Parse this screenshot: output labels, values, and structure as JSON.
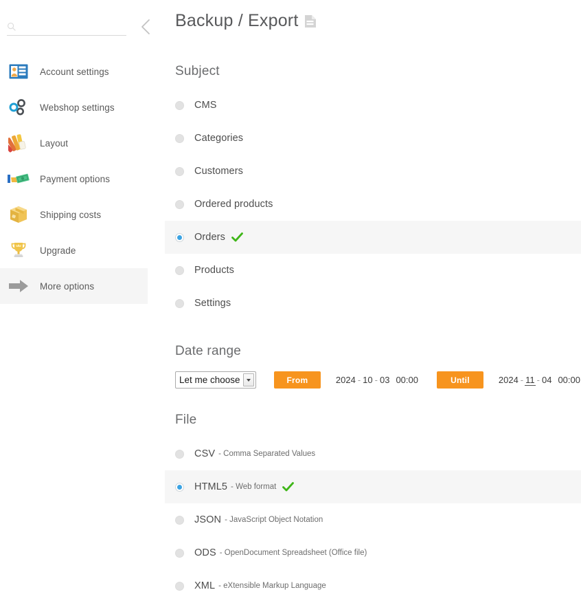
{
  "sidebar": {
    "search": {
      "value": "",
      "placeholder": "",
      "icon": "search-icon"
    },
    "collapse_icon": "chevron-left-icon",
    "items": [
      {
        "label": "Account settings",
        "icon": "id-card-icon",
        "active": false
      },
      {
        "label": "Webshop settings",
        "icon": "gears-icon",
        "active": false
      },
      {
        "label": "Layout",
        "icon": "color-fan-icon",
        "active": false
      },
      {
        "label": "Payment options",
        "icon": "money-hand-icon",
        "active": false
      },
      {
        "label": "Shipping costs",
        "icon": "box-icon",
        "active": false
      },
      {
        "label": "Upgrade",
        "icon": "trophy-icon",
        "active": false
      },
      {
        "label": "More options",
        "icon": "arrow-right-icon",
        "active": true
      }
    ]
  },
  "main": {
    "title": "Backup / Export",
    "title_icon": "document-icon",
    "subject": {
      "heading": "Subject",
      "options": [
        {
          "label": "CMS",
          "selected": false
        },
        {
          "label": "Categories",
          "selected": false
        },
        {
          "label": "Customers",
          "selected": false
        },
        {
          "label": "Ordered products",
          "selected": false
        },
        {
          "label": "Orders",
          "selected": true
        },
        {
          "label": "Products",
          "selected": false
        },
        {
          "label": "Settings",
          "selected": false
        }
      ]
    },
    "date_range": {
      "heading": "Date range",
      "select": {
        "value": "Let me choose",
        "options": [
          "Let me choose"
        ]
      },
      "from": {
        "button_label": "From",
        "year": "2024",
        "month": "10",
        "day": "03",
        "time": "00:00",
        "focused_segment": ""
      },
      "until": {
        "button_label": "Until",
        "year": "2024",
        "month": "11",
        "day": "04",
        "time": "00:00",
        "focused_segment": "month"
      }
    },
    "file": {
      "heading": "File",
      "options": [
        {
          "label": "CSV",
          "desc": "- Comma Separated Values",
          "selected": false
        },
        {
          "label": "HTML5",
          "desc": "- Web format",
          "selected": true
        },
        {
          "label": "JSON",
          "desc": "- JavaScript Object Notation",
          "selected": false
        },
        {
          "label": "ODS",
          "desc": "- OpenDocument Spreadsheet (Office file)",
          "selected": false
        },
        {
          "label": "XML",
          "desc": "- eXtensible Markup Language",
          "selected": false
        }
      ]
    }
  },
  "colors": {
    "accent_orange": "#f7941e",
    "radio_blue": "#3ba3e3",
    "check_green": "#3fb618",
    "row_highlight": "#f6f6f6",
    "text": "#4d4d4d"
  }
}
